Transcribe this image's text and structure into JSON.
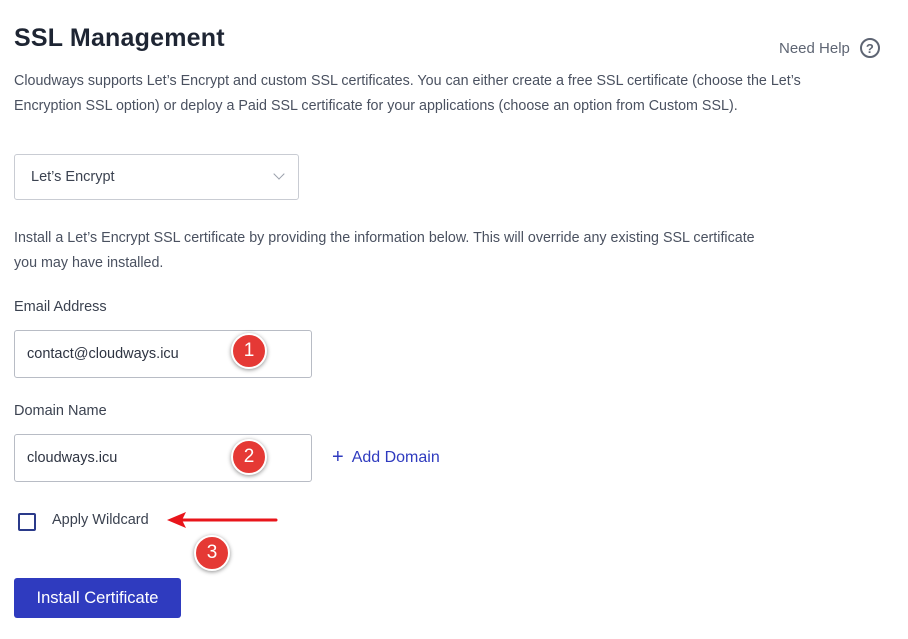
{
  "page": {
    "title": "SSL Management",
    "help_label": "Need Help",
    "help_icon": "question-circle-icon",
    "description": "Cloudways supports Let’s Encrypt and custom SSL certificates. You can either create a free SSL certificate (choose the Let’s Encryption SSL option) or deploy a Paid SSL certificate for your applications (choose an option from Custom SSL)."
  },
  "ssl_type": {
    "selected": "Let’s Encrypt"
  },
  "form": {
    "instructions": "Install a Let’s Encrypt SSL certificate by providing the information below. This will override any existing SSL certificate you may have installed.",
    "email_label": "Email Address",
    "email_value": "contact@cloudways.icu",
    "domain_label": "Domain Name",
    "domain_value": "cloudways.icu",
    "add_domain_label": "Add Domain",
    "wildcard_label": "Apply Wildcard",
    "wildcard_checked": false,
    "install_label": "Install Certificate"
  },
  "annotations": {
    "step1": "1",
    "step2": "2",
    "step3": "3",
    "badge_color": "#e53935",
    "arrow_color": "#e8151b"
  },
  "colors": {
    "accent": "#2f3bbf",
    "title": "#1e2533"
  }
}
